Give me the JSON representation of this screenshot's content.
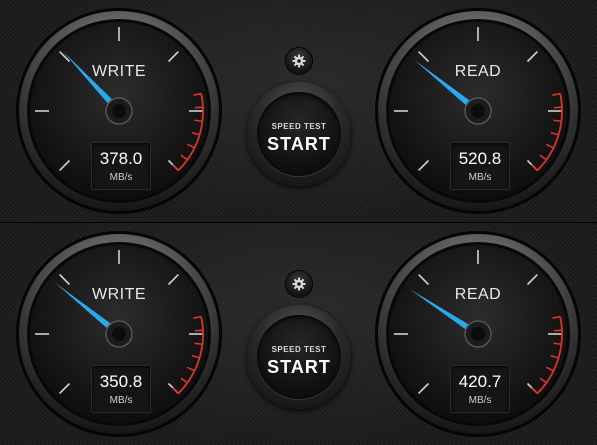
{
  "panels": [
    {
      "write": {
        "label": "WRITE",
        "value": "378.0",
        "unit": "MB/s",
        "needle_level": 0.34
      },
      "read": {
        "label": "READ",
        "value": "520.8",
        "unit": "MB/s",
        "needle_level": 0.31
      },
      "settings_icon": "gear-icon",
      "button": {
        "small": "SPEED TEST",
        "big": "START"
      }
    },
    {
      "write": {
        "label": "WRITE",
        "value": "350.8",
        "unit": "MB/s",
        "needle_level": 0.31
      },
      "read": {
        "label": "READ",
        "value": "420.7",
        "unit": "MB/s",
        "needle_level": 0.29
      },
      "settings_icon": "gear-icon",
      "button": {
        "small": "SPEED TEST",
        "big": "START"
      }
    }
  ],
  "colors": {
    "needle": "#29aaf0",
    "redline": "#d9352a",
    "tick": "#d0d0d0",
    "background": "#1e1e1e"
  }
}
